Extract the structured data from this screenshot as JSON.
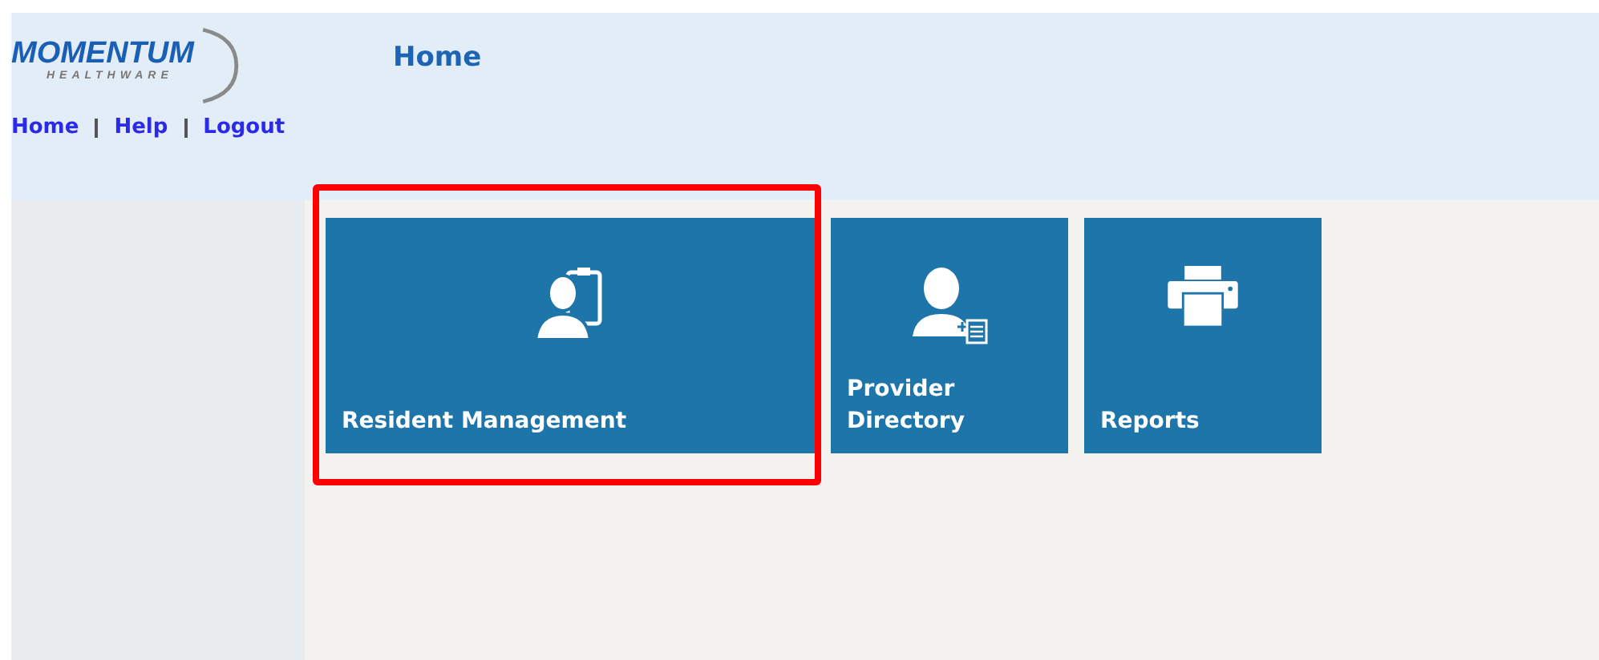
{
  "logo": {
    "name": "MOMENTUM",
    "subtitle": "HEALTHWARE"
  },
  "nav": [
    {
      "label": "Home"
    },
    {
      "label": "Help"
    },
    {
      "label": "Logout"
    }
  ],
  "page_title": "Home",
  "tiles": [
    {
      "label": "Resident Management",
      "kind": "resident",
      "highlighted": true
    },
    {
      "label": "Provider Directory",
      "kind": "provider",
      "highlighted": false
    },
    {
      "label": "Reports",
      "kind": "reports",
      "highlighted": false
    }
  ]
}
